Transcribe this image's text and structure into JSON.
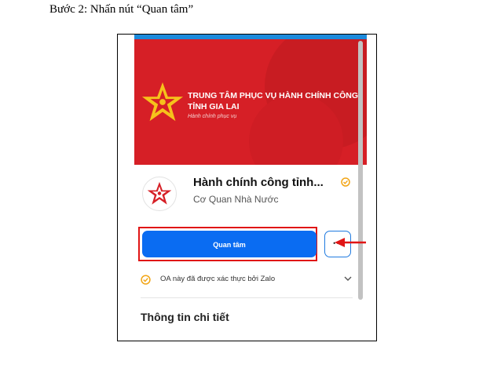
{
  "step_text": "Bước 2: Nhấn nút “Quan tâm”",
  "banner": {
    "title_line1": "TRUNG TÂM PHỤC VỤ HÀNH CHÍNH CÔNG",
    "title_line2": "TỈNH GIA LAI",
    "subtitle": "Hành chính phục vụ"
  },
  "oa": {
    "name": "Hành chính công tỉnh...",
    "category": "Cơ Quan Nhà Nước"
  },
  "actions": {
    "follow_label": "Quan tâm",
    "more_label": "⋯"
  },
  "verified_text": "OA này đã được xác thực bởi Zalo",
  "detail_title": "Thông tin chi tiết",
  "colors": {
    "brand_red": "#d61f26",
    "zalo_blue": "#0a6cf2",
    "annotation_red": "#e01515",
    "verified_gold": "#f2a516"
  },
  "icons": [
    "logo-star-icon",
    "verified-check-icon",
    "more-dots-icon",
    "annotation-arrow-icon",
    "chevron-down-icon"
  ]
}
